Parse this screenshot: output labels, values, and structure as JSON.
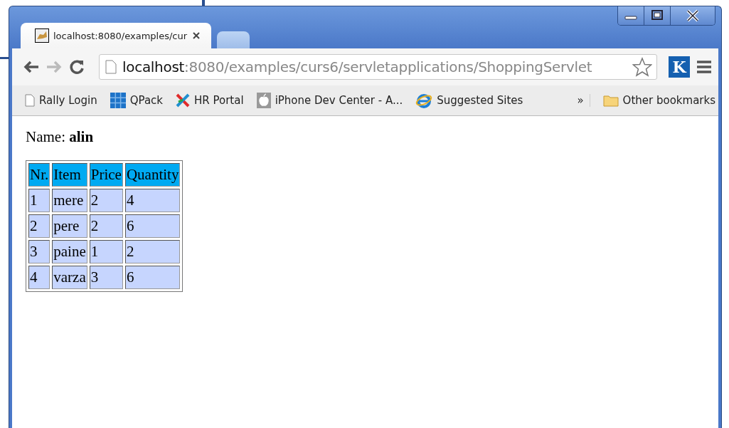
{
  "tabs": [
    {
      "title": "localhost:8080/examples/cur",
      "selected": true
    },
    {
      "selected": false
    }
  ],
  "address": {
    "host": "localhost",
    "path": ":8080/examples/curs6/servletapplications/ShoppingServlet"
  },
  "extension_label": "K",
  "bookmarks": [
    {
      "kind": "page",
      "label": "Rally Login"
    },
    {
      "kind": "grid",
      "label": "QPack"
    },
    {
      "kind": "cross",
      "label": "HR Portal"
    },
    {
      "kind": "apple",
      "label": "iPhone Dev Center - A..."
    },
    {
      "kind": "ie",
      "label": "Suggested Sites"
    }
  ],
  "bookmarks_overflow": "»",
  "other_bookmarks": "Other bookmarks",
  "page": {
    "name_label": "Name:",
    "name_value": "alin",
    "table": {
      "columns": [
        "Nr.",
        "Item",
        "Price",
        "Quantity"
      ],
      "rows": [
        [
          "1",
          "mere",
          "2",
          "4"
        ],
        [
          "2",
          "pere",
          "2",
          "6"
        ],
        [
          "3",
          "paine",
          "1",
          "2"
        ],
        [
          "4",
          "varza",
          "3",
          "6"
        ]
      ]
    }
  }
}
